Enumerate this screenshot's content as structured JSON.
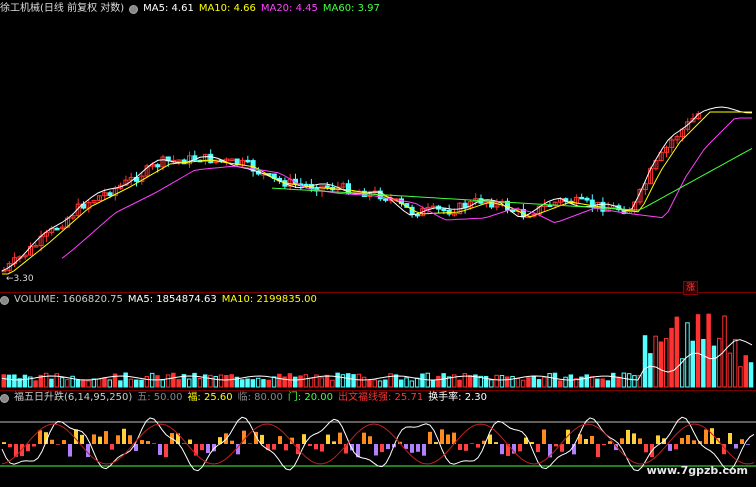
{
  "stock": {
    "title": "徐工机械(日线 前复权 对数)"
  },
  "main_indicators": [
    {
      "label": "MA5: 4.61",
      "color": "#ffffff"
    },
    {
      "label": "MA10: 4.66",
      "color": "#ffff00"
    },
    {
      "label": "MA20: 4.45",
      "color": "#ff40ff"
    },
    {
      "label": "MA60: 3.97",
      "color": "#40ff40"
    }
  ],
  "low_price_label": "←3.30",
  "limit_up_tag": "涨",
  "volume_indicators": [
    {
      "label": "VOLUME: 1606820.75",
      "color": "#cccccc"
    },
    {
      "label": "MA5: 1854874.63",
      "color": "#ffffff"
    },
    {
      "label": "MA10: 2199835.00",
      "color": "#ffff00"
    }
  ],
  "fuwu_indicators": [
    {
      "label": "福五日升跌(6,14,95,250)",
      "color": "#cccccc"
    },
    {
      "label": "五: 50.00",
      "color": "#888888"
    },
    {
      "label": "福: 25.60",
      "color": "#ffff00"
    },
    {
      "label": "临: 80.00",
      "color": "#888888"
    },
    {
      "label": "门: 20.00",
      "color": "#40ff40"
    },
    {
      "label": "出文福线强: 25.71",
      "color": "#ff3030"
    },
    {
      "label": "换手率: 2.30",
      "color": "#ffffff"
    }
  ],
  "watermark": "www.7gpzb.com",
  "colors": {
    "up": "#ff3232",
    "down": "#54ffff",
    "bg": "#000000",
    "grid": "#7a0000"
  }
}
